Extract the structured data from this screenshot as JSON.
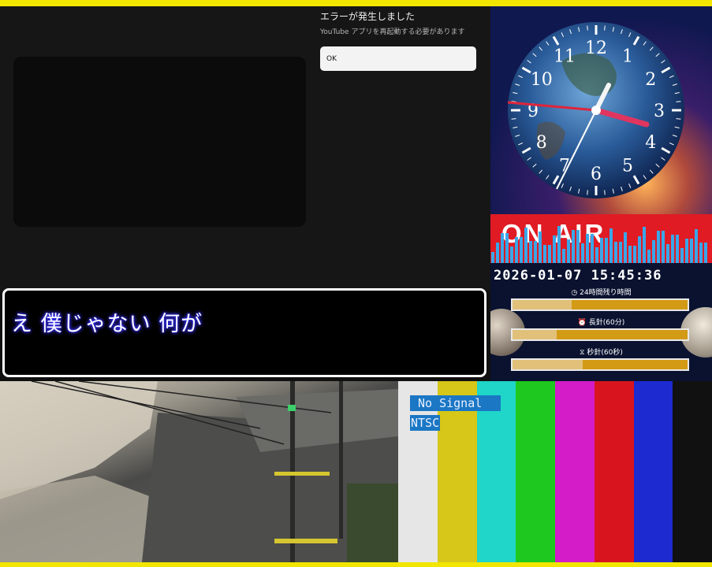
{
  "youtube_error": {
    "title": "エラーが発生しました",
    "message": "YouTube アプリを再起動する必要があります",
    "ok_label": "OK"
  },
  "subtitle": {
    "text": "え 僕じゃない 何が"
  },
  "clock": {
    "numerals": [
      "12",
      "1",
      "2",
      "3",
      "4",
      "5",
      "6",
      "7",
      "8",
      "9",
      "10",
      "11"
    ]
  },
  "on_air": {
    "label": "ON AIR"
  },
  "status": {
    "datetime": "2026-01-07 15:45:36",
    "remaining_24h_label": "24時間残り時間",
    "remaining_24h_fraction": 0.34,
    "minute_hand_label": "長針(60分)",
    "minute_hand_fraction": 0.25,
    "second_hand_label": "秒針(60秒)",
    "second_hand_fraction": 0.4
  },
  "signal": {
    "no_signal": "No Signal",
    "format": "NTSC",
    "bar_colors": [
      "#e6e6e6",
      "#d6c718",
      "#1fd6c8",
      "#1ec81e",
      "#d41cc8",
      "#d8141e",
      "#1c2ad0",
      "#111111"
    ]
  },
  "icons": {
    "clock_icon": "clock-icon",
    "minute_icon": "alarm-icon",
    "second_icon": "hourglass-icon"
  }
}
